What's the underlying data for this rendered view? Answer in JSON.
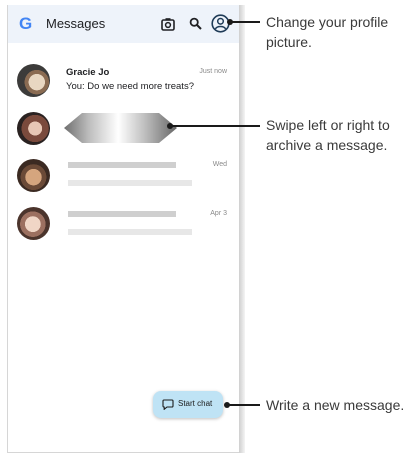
{
  "app": {
    "logo_letter": "G",
    "title": "Messages"
  },
  "icons": {
    "camera": "camera-icon",
    "search": "search-icon",
    "profile": "account-circle-icon",
    "chat": "chat-bubble-icon"
  },
  "conversations": [
    {
      "sender": "Gracie Jo",
      "snippet": "You: Do we need more treats?",
      "time": "Just now"
    },
    {
      "sender": "",
      "snippet": "",
      "time": ""
    },
    {
      "sender": "",
      "snippet": "",
      "time": "Wed"
    },
    {
      "sender": "",
      "snippet": "",
      "time": "Apr 3"
    }
  ],
  "start_chat_label": "Start chat",
  "callouts": {
    "profile": "Change your profile picture.",
    "swipe": "Swipe left or right to archive a message.",
    "new_message": "Write a new message."
  },
  "colors": {
    "top_bar": "#eef3fa",
    "start_chat_button": "#bfe3f5",
    "google_blue": "#4285f4"
  }
}
